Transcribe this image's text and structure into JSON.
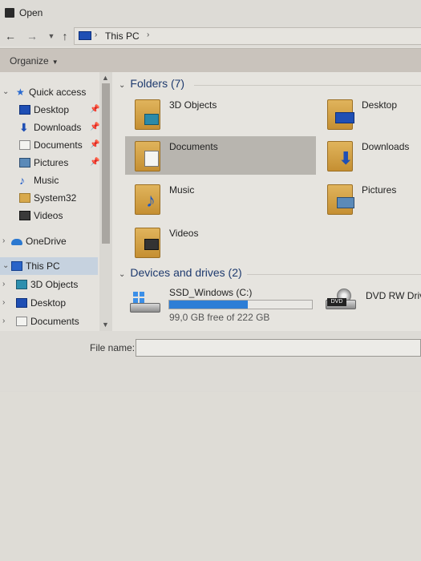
{
  "window": {
    "title": "Open"
  },
  "address": {
    "location": "This PC"
  },
  "toolbar": {
    "organize_label": "Organize"
  },
  "nav": {
    "quick_access": "Quick access",
    "items": [
      {
        "label": "Desktop",
        "icon": "desktop-icon",
        "pinned": true
      },
      {
        "label": "Downloads",
        "icon": "downloads-icon",
        "pinned": true
      },
      {
        "label": "Documents",
        "icon": "documents-icon",
        "pinned": true
      },
      {
        "label": "Pictures",
        "icon": "pictures-icon",
        "pinned": true
      },
      {
        "label": "Music",
        "icon": "music-icon",
        "pinned": false
      },
      {
        "label": "System32",
        "icon": "folder-icon",
        "pinned": false
      },
      {
        "label": "Videos",
        "icon": "videos-icon",
        "pinned": false
      }
    ],
    "onedrive": "OneDrive",
    "this_pc": "This PC",
    "this_pc_children": [
      {
        "label": "3D Objects",
        "icon": "3d-objects-icon"
      },
      {
        "label": "Desktop",
        "icon": "desktop-icon"
      },
      {
        "label": "Documents",
        "icon": "documents-icon"
      }
    ]
  },
  "content": {
    "folders_header": "Folders (7)",
    "folders": [
      {
        "label": "3D Objects",
        "icon": "3d-objects-icon"
      },
      {
        "label": "Desktop",
        "icon": "desktop-icon"
      },
      {
        "label": "Documents",
        "icon": "documents-icon",
        "selected": true
      },
      {
        "label": "Downloads",
        "icon": "downloads-icon"
      },
      {
        "label": "Music",
        "icon": "music-icon"
      },
      {
        "label": "Pictures",
        "icon": "pictures-icon"
      },
      {
        "label": "Videos",
        "icon": "videos-icon"
      }
    ],
    "drives_header": "Devices and drives (2)",
    "drives": [
      {
        "label": "SSD_Windows (C:)",
        "free_text": "99,0 GB free of 222 GB",
        "used_fraction": 0.55
      },
      {
        "label": "DVD RW Drive",
        "badge": "DVD"
      }
    ]
  },
  "footer": {
    "filename_label": "File name:",
    "filename_value": ""
  },
  "colors": {
    "accent": "#2d7ed6",
    "selection": "#b8b5af",
    "nav_selection": "#c6d2df"
  }
}
